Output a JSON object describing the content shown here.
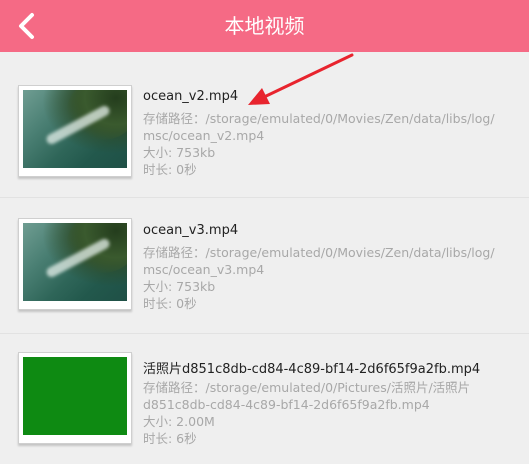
{
  "header": {
    "title": "本地视频",
    "background": "#f56a85"
  },
  "videos": [
    {
      "name": "ocean_v2.mp4",
      "path_line1": "存储路径：/storage/emulated/0/Movies/Zen/data/libs/log/",
      "path_line2": "msc/ocean_v2.mp4",
      "size": "大小: 753kb",
      "duration": "时长: 0秒",
      "thumbnail": "ocean-coast"
    },
    {
      "name": "ocean_v3.mp4",
      "path_line1": "存储路径：/storage/emulated/0/Movies/Zen/data/libs/log/",
      "path_line2": "msc/ocean_v3.mp4",
      "size": "大小: 753kb",
      "duration": "时长: 0秒",
      "thumbnail": "ocean-coast"
    },
    {
      "name": "活照片d851c8db-cd84-4c89-bf14-2d6f65f9a2fb.mp4",
      "path_line1": "存储路径：/storage/emulated/0/Pictures/活照片/活照片",
      "path_line2": "d851c8db-cd84-4c89-bf14-2d6f65f9a2fb.mp4",
      "size": "大小: 2.00M",
      "duration": "时长: 6秒",
      "thumbnail": "solid-green"
    }
  ],
  "annotation_color": "#e8242e"
}
